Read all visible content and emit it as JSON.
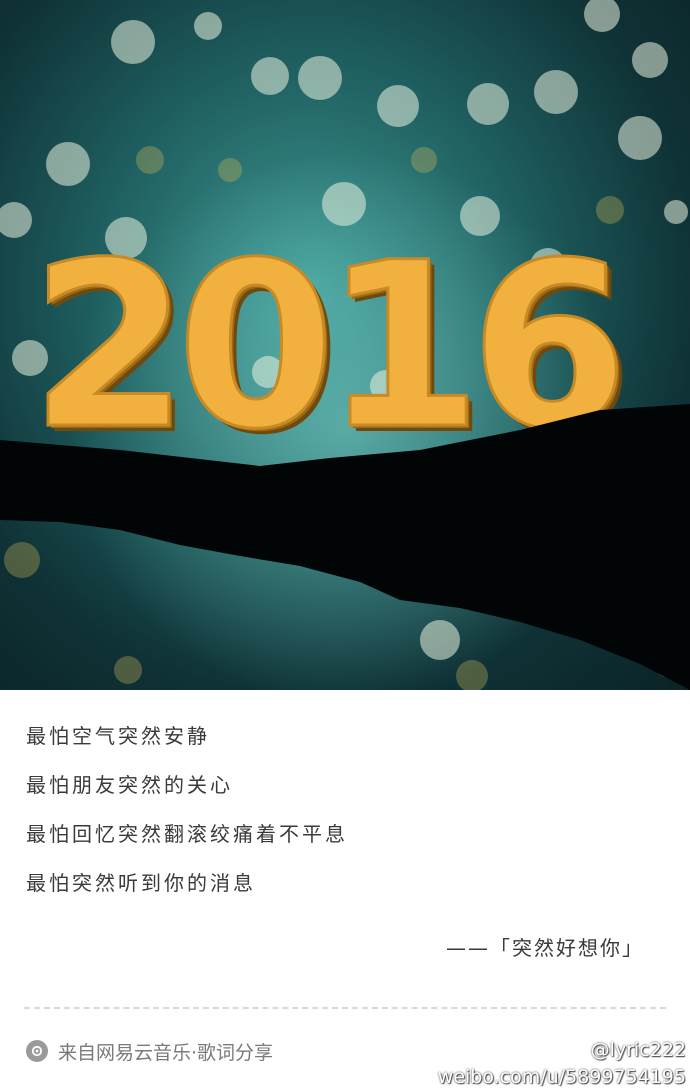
{
  "hero": {
    "year_text": "2016"
  },
  "lyrics": [
    "最怕空气突然安静",
    "最怕朋友突然的关心",
    "最怕回忆突然翻滚绞痛着不平息",
    "最怕突然听到你的消息"
  ],
  "attribution": "——「突然好想你」",
  "footer": {
    "source_icon": "netease-music-icon",
    "source_text": "来自网易云音乐·歌词分享"
  },
  "watermark": {
    "icon": "weibo-icon",
    "handle": "@lyric222",
    "url": "weibo.com/u/5899754195"
  }
}
